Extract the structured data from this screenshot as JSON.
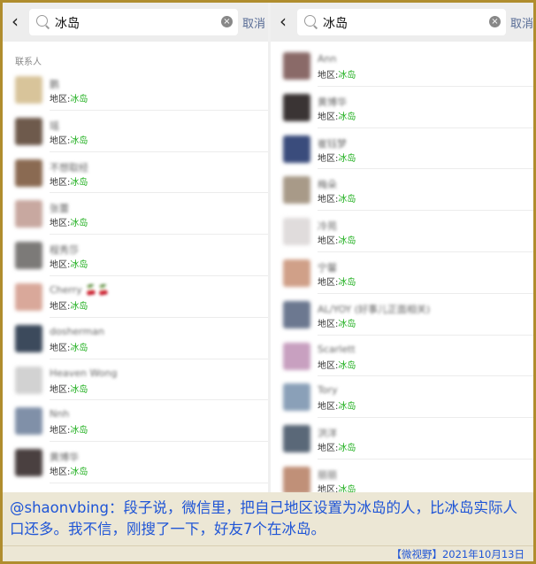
{
  "search": {
    "query": "冰岛",
    "cancel_label": "取消"
  },
  "left_panel": {
    "section_label": "联系人",
    "contacts": [
      {
        "name": "鹏",
        "region_prefix": "地区:",
        "region": "冰岛",
        "color": "#d8c49a"
      },
      {
        "name": "瑶",
        "region_prefix": "地区:",
        "region": "冰岛",
        "color": "#6e5a4c"
      },
      {
        "name": "不想取经",
        "region_prefix": "地区:",
        "region": "冰岛",
        "color": "#8a6a52"
      },
      {
        "name": "张蕾",
        "region_prefix": "地区:",
        "region": "冰岛",
        "color": "#c8a8a0"
      },
      {
        "name": "程秀莎",
        "region_prefix": "地区:",
        "region": "冰岛",
        "color": "#7c7a78"
      },
      {
        "name": "Cherry 🍒🍒",
        "region_prefix": "地区:",
        "region": "冰岛",
        "color": "#d9a89a"
      },
      {
        "name": "dosherman",
        "region_prefix": "地区:",
        "region": "冰岛",
        "color": "#3c4a5c"
      },
      {
        "name": "Heaven Wong",
        "region_prefix": "地区:",
        "region": "冰岛",
        "color": "#d2d2d2"
      },
      {
        "name": "Nnh",
        "region_prefix": "地区:",
        "region": "冰岛",
        "color": "#8090a8"
      },
      {
        "name": "黄博华",
        "region_prefix": "地区:",
        "region": "冰岛",
        "color": "#4a4040"
      }
    ]
  },
  "right_panel": {
    "contacts": [
      {
        "name": "Ann",
        "region_prefix": "地区:",
        "region": "冰岛",
        "color": "#8a6a68"
      },
      {
        "name": "黄博华",
        "region_prefix": "地区:",
        "region": "冰岛",
        "color": "#3a3434"
      },
      {
        "name": "崔钰梦",
        "region_prefix": "地区:",
        "region": "冰岛",
        "color": "#3a4c7c"
      },
      {
        "name": "梅朵",
        "region_prefix": "地区:",
        "region": "冰岛",
        "color": "#a89a88"
      },
      {
        "name": "冷苑",
        "region_prefix": "地区:",
        "region": "冰岛",
        "color": "#e0dcdc"
      },
      {
        "name": "宁馨",
        "region_prefix": "地区:",
        "region": "冰岛",
        "color": "#d0a088"
      },
      {
        "name": "AL/YOY (好事儿正面相关)",
        "region_prefix": "地区:",
        "region": "冰岛",
        "color": "#6c7890"
      },
      {
        "name": "Scarlett",
        "region_prefix": "地区:",
        "region": "冰岛",
        "color": "#c8a0c0"
      },
      {
        "name": "Tory",
        "region_prefix": "地区:",
        "region": "冰岛",
        "color": "#8aa0b8"
      },
      {
        "name": "洪洋",
        "region_prefix": "地区:",
        "region": "冰岛",
        "color": "#5a6878"
      },
      {
        "name": "丽丽",
        "region_prefix": "地区:",
        "region": "冰岛",
        "color": "#c09078"
      }
    ]
  },
  "caption": {
    "text": "@shaonvbing：段子说，微信里，把自己地区设置为冰岛的人，比冰岛实际人口还多。我不信，刚搜了一下，好友7个在冰岛。",
    "credit": "【微视野】2021年10月13日"
  }
}
